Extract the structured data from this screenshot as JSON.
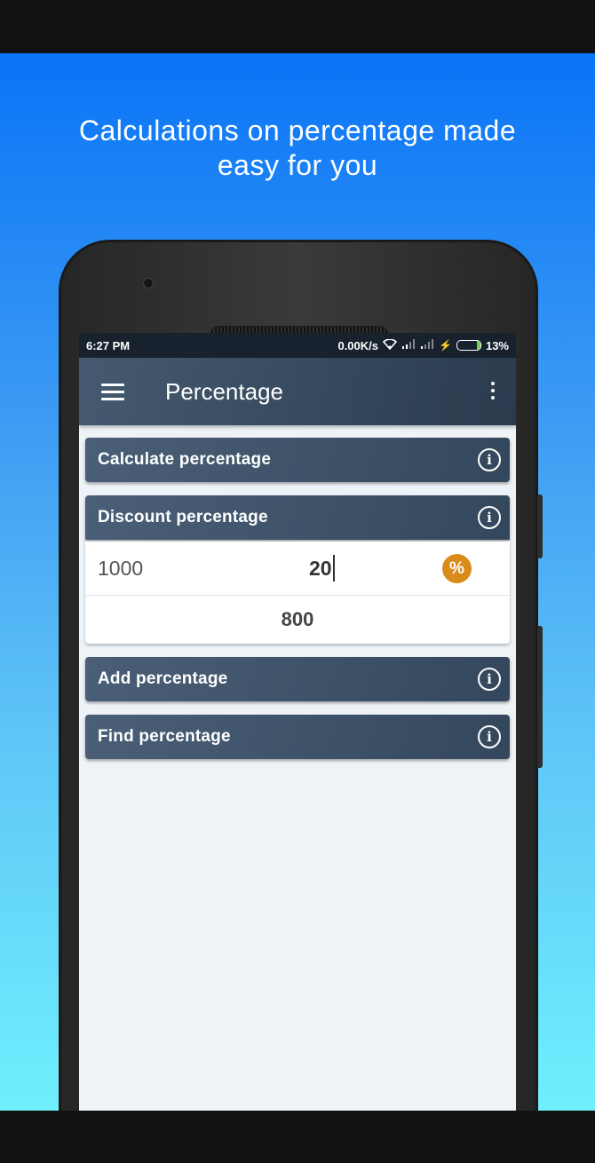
{
  "promo": {
    "headline_line1": "Calculations on percentage made",
    "headline_line2": "easy for you"
  },
  "status_bar": {
    "time": "6:27 PM",
    "network_speed": "0.00K/s",
    "battery": "13%"
  },
  "app_bar": {
    "title": "Percentage",
    "menu_icon": "hamburger-icon",
    "overflow_icon": "more-vert-icon"
  },
  "sections": [
    {
      "label": "Calculate percentage",
      "icon": "info-icon",
      "expanded": false
    },
    {
      "label": "Discount percentage",
      "icon": "info-icon",
      "expanded": true
    },
    {
      "label": "Add percentage",
      "icon": "info-icon",
      "expanded": false
    },
    {
      "label": "Find percentage",
      "icon": "info-icon",
      "expanded": false
    }
  ],
  "discount": {
    "base_value": "1000",
    "percent_value": "20",
    "percent_symbol": "%",
    "result": "800"
  },
  "colors": {
    "accent": "#d98b1b",
    "card": "#3d5168",
    "bg_top": "#0a74f7",
    "bg_bottom": "#6ff0fd"
  }
}
